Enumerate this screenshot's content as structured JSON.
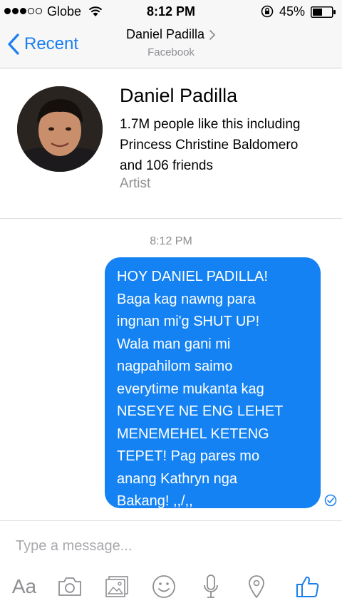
{
  "status_bar": {
    "carrier": "Globe",
    "time": "8:12 PM",
    "battery": "45%"
  },
  "nav": {
    "back_label": "Recent",
    "title": "Daniel Padilla",
    "subtitle": "Facebook"
  },
  "profile": {
    "name": "Daniel Padilla",
    "likes_lines": [
      "1.7M people like this including",
      "Princess Christine Baldomero",
      "and 106 friends"
    ],
    "category": "Artist"
  },
  "conversation": {
    "timestamp": "8:12 PM",
    "message_lines": [
      "HOY DANIEL PADILLA!",
      "Baga kag nawng para",
      "ingnan mi'g SHUT UP!",
      "Wala man gani mi",
      "nagpahilom saimo",
      "everytime mukanta kag",
      "NESEYE NE ENG LEHET",
      "MENEMEHEL KETENG",
      "TEPET! Pag pares mo",
      "anang Kathryn nga",
      "Bakang! ,,/,,"
    ]
  },
  "composer": {
    "placeholder": "Type a message...",
    "text_button_label": "Aa",
    "accent_color": "#1a7ef0",
    "icon_color": "#8e8e93"
  }
}
